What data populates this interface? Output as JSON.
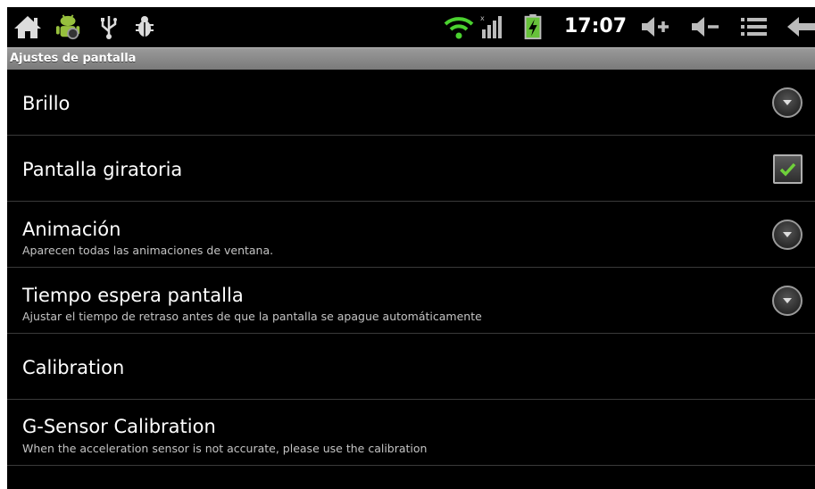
{
  "status_bar": {
    "icons_left": [
      "home-icon",
      "android-debug-icon",
      "usb-icon",
      "bug-icon"
    ],
    "icons_right": [
      "wifi-icon",
      "signal-icon",
      "battery-charging-icon"
    ],
    "time": "17:07",
    "buttons": [
      "volume-up-icon",
      "volume-down-icon",
      "menu-icon",
      "back-icon"
    ],
    "colors": {
      "wifi": "#4ad12f",
      "battery": "#67c23a"
    }
  },
  "title": "Ajustes de pantalla",
  "settings": [
    {
      "title": "Brillo",
      "summary": "",
      "control": "spinner"
    },
    {
      "title": "Pantalla giratoria",
      "summary": "",
      "control": "checkbox",
      "checked": true
    },
    {
      "title": "Animación",
      "summary": "Aparecen todas las animaciones de ventana.",
      "control": "spinner"
    },
    {
      "title": "Tiempo espera pantalla",
      "summary": "Ajustar el tiempo de retraso antes de que la pantalla se apague automáticamente",
      "control": "spinner"
    },
    {
      "title": "Calibration",
      "summary": "",
      "control": "none"
    },
    {
      "title": "G-Sensor Calibration",
      "summary": "When the acceleration sensor is not accurate, please use the calibration",
      "control": "none"
    }
  ]
}
